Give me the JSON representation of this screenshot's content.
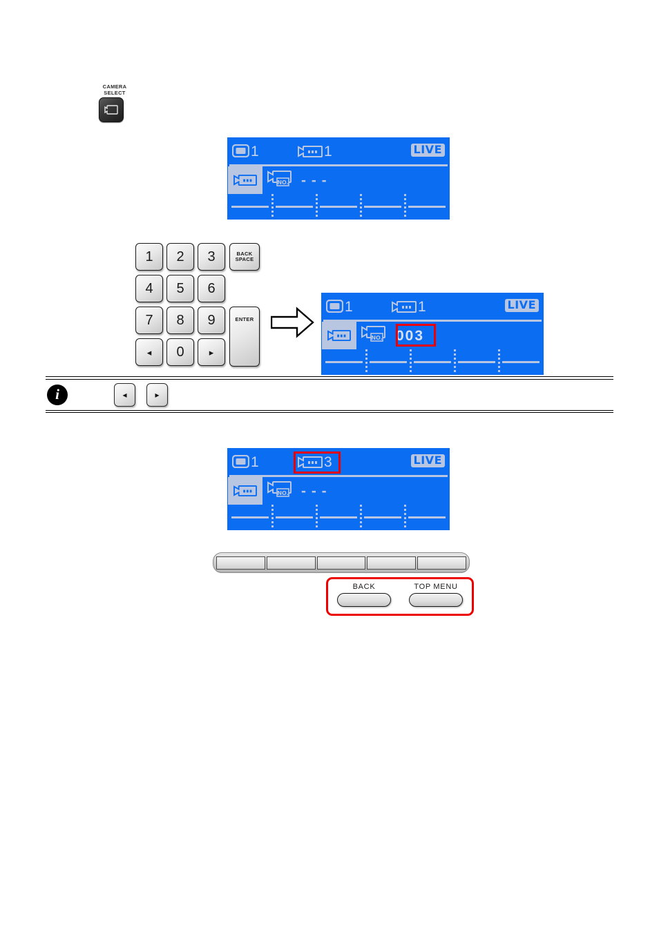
{
  "camera_select": {
    "label_line1": "CAMERA",
    "label_line2": "SELECT",
    "icon": "camera-monitor-icon"
  },
  "lcd_panels": [
    {
      "id": "lcd-initial",
      "monitor_icon": "monitor-icon",
      "monitor_number": "1",
      "camera_icon": "camcorder-icon",
      "camera_number": "1",
      "status_badge": "LIVE",
      "row2_selected_icon": "camcorder-icon",
      "row2_field_icon": "camcorder-no-icon",
      "row2_field_sublabel": "NO.",
      "row2_value": "- - -",
      "softkey_labels": [
        "",
        "",
        "",
        "",
        ""
      ],
      "highlight": "none"
    },
    {
      "id": "lcd-entered",
      "monitor_icon": "monitor-icon",
      "monitor_number": "1",
      "camera_icon": "camcorder-icon",
      "camera_number": "1",
      "status_badge": "LIVE",
      "row2_selected_icon": "camcorder-icon",
      "row2_field_icon": "camcorder-no-icon",
      "row2_field_sublabel": "NO.",
      "row2_value": "003",
      "softkey_labels": [
        "",
        "",
        "",
        "",
        ""
      ],
      "highlight": "value"
    },
    {
      "id": "lcd-result",
      "monitor_icon": "monitor-icon",
      "monitor_number": "1",
      "camera_icon": "camcorder-icon",
      "camera_number": "3",
      "status_badge": "LIVE",
      "row2_selected_icon": "camcorder-icon",
      "row2_field_icon": "camcorder-no-icon",
      "row2_field_sublabel": "NO.",
      "row2_value": "- - -",
      "softkey_labels": [
        "",
        "",
        "",
        "",
        ""
      ],
      "highlight": "camera-number"
    }
  ],
  "keypad": {
    "keys": [
      {
        "label": "1",
        "kind": "digit"
      },
      {
        "label": "2",
        "kind": "digit"
      },
      {
        "label": "3",
        "kind": "digit"
      },
      {
        "label_line1": "BACK",
        "label_line2": "SPACE",
        "kind": "text"
      },
      {
        "label": "4",
        "kind": "digit"
      },
      {
        "label": "5",
        "kind": "digit"
      },
      {
        "label": "6",
        "kind": "digit"
      },
      {
        "label": "7",
        "kind": "digit"
      },
      {
        "label": "8",
        "kind": "digit"
      },
      {
        "label": "9",
        "kind": "digit"
      },
      {
        "label": "ENTER",
        "kind": "text"
      },
      {
        "label": "◂",
        "kind": "arrow-left"
      },
      {
        "label": "0",
        "kind": "digit"
      },
      {
        "label": "▸",
        "kind": "arrow-right"
      }
    ]
  },
  "flow_arrow": {
    "icon": "arrow-right-block-icon"
  },
  "note": {
    "icon": "info-icon",
    "icon_glyph": "i",
    "text": "",
    "keys": [
      {
        "label": "◂",
        "name": "arrow-left-key"
      },
      {
        "label": "▸",
        "name": "arrow-right-key"
      }
    ]
  },
  "softkey_strip": {
    "segments": [
      "",
      "",
      "",
      "",
      ""
    ]
  },
  "bottom_keys": [
    {
      "label": "BACK",
      "name": "back-button"
    },
    {
      "label": "TOP MENU",
      "name": "top-menu-button"
    }
  ]
}
